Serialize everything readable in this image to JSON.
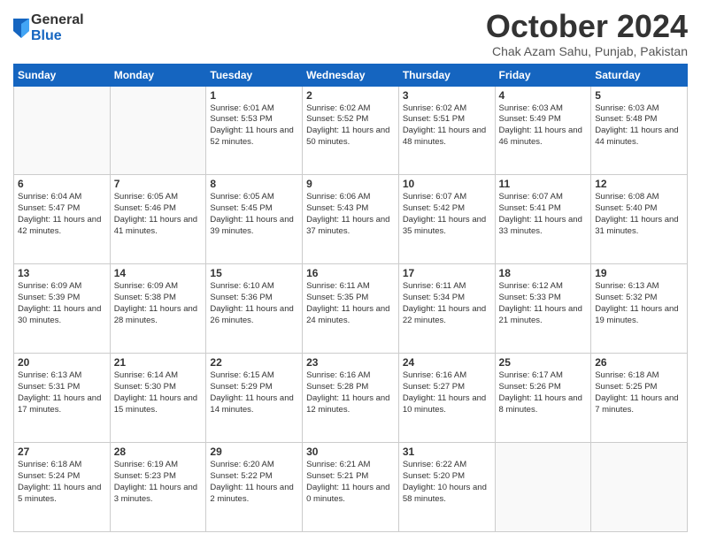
{
  "header": {
    "logo_general": "General",
    "logo_blue": "Blue",
    "title": "October 2024",
    "location": "Chak Azam Sahu, Punjab, Pakistan"
  },
  "columns": [
    "Sunday",
    "Monday",
    "Tuesday",
    "Wednesday",
    "Thursday",
    "Friday",
    "Saturday"
  ],
  "weeks": [
    [
      {
        "day": "",
        "empty": true
      },
      {
        "day": "",
        "empty": true
      },
      {
        "day": "1",
        "sunrise": "6:01 AM",
        "sunset": "5:53 PM",
        "daylight": "11 hours and 52 minutes."
      },
      {
        "day": "2",
        "sunrise": "6:02 AM",
        "sunset": "5:52 PM",
        "daylight": "11 hours and 50 minutes."
      },
      {
        "day": "3",
        "sunrise": "6:02 AM",
        "sunset": "5:51 PM",
        "daylight": "11 hours and 48 minutes."
      },
      {
        "day": "4",
        "sunrise": "6:03 AM",
        "sunset": "5:49 PM",
        "daylight": "11 hours and 46 minutes."
      },
      {
        "day": "5",
        "sunrise": "6:03 AM",
        "sunset": "5:48 PM",
        "daylight": "11 hours and 44 minutes."
      }
    ],
    [
      {
        "day": "6",
        "sunrise": "6:04 AM",
        "sunset": "5:47 PM",
        "daylight": "11 hours and 42 minutes."
      },
      {
        "day": "7",
        "sunrise": "6:05 AM",
        "sunset": "5:46 PM",
        "daylight": "11 hours and 41 minutes."
      },
      {
        "day": "8",
        "sunrise": "6:05 AM",
        "sunset": "5:45 PM",
        "daylight": "11 hours and 39 minutes."
      },
      {
        "day": "9",
        "sunrise": "6:06 AM",
        "sunset": "5:43 PM",
        "daylight": "11 hours and 37 minutes."
      },
      {
        "day": "10",
        "sunrise": "6:07 AM",
        "sunset": "5:42 PM",
        "daylight": "11 hours and 35 minutes."
      },
      {
        "day": "11",
        "sunrise": "6:07 AM",
        "sunset": "5:41 PM",
        "daylight": "11 hours and 33 minutes."
      },
      {
        "day": "12",
        "sunrise": "6:08 AM",
        "sunset": "5:40 PM",
        "daylight": "11 hours and 31 minutes."
      }
    ],
    [
      {
        "day": "13",
        "sunrise": "6:09 AM",
        "sunset": "5:39 PM",
        "daylight": "11 hours and 30 minutes."
      },
      {
        "day": "14",
        "sunrise": "6:09 AM",
        "sunset": "5:38 PM",
        "daylight": "11 hours and 28 minutes."
      },
      {
        "day": "15",
        "sunrise": "6:10 AM",
        "sunset": "5:36 PM",
        "daylight": "11 hours and 26 minutes."
      },
      {
        "day": "16",
        "sunrise": "6:11 AM",
        "sunset": "5:35 PM",
        "daylight": "11 hours and 24 minutes."
      },
      {
        "day": "17",
        "sunrise": "6:11 AM",
        "sunset": "5:34 PM",
        "daylight": "11 hours and 22 minutes."
      },
      {
        "day": "18",
        "sunrise": "6:12 AM",
        "sunset": "5:33 PM",
        "daylight": "11 hours and 21 minutes."
      },
      {
        "day": "19",
        "sunrise": "6:13 AM",
        "sunset": "5:32 PM",
        "daylight": "11 hours and 19 minutes."
      }
    ],
    [
      {
        "day": "20",
        "sunrise": "6:13 AM",
        "sunset": "5:31 PM",
        "daylight": "11 hours and 17 minutes."
      },
      {
        "day": "21",
        "sunrise": "6:14 AM",
        "sunset": "5:30 PM",
        "daylight": "11 hours and 15 minutes."
      },
      {
        "day": "22",
        "sunrise": "6:15 AM",
        "sunset": "5:29 PM",
        "daylight": "11 hours and 14 minutes."
      },
      {
        "day": "23",
        "sunrise": "6:16 AM",
        "sunset": "5:28 PM",
        "daylight": "11 hours and 12 minutes."
      },
      {
        "day": "24",
        "sunrise": "6:16 AM",
        "sunset": "5:27 PM",
        "daylight": "11 hours and 10 minutes."
      },
      {
        "day": "25",
        "sunrise": "6:17 AM",
        "sunset": "5:26 PM",
        "daylight": "11 hours and 8 minutes."
      },
      {
        "day": "26",
        "sunrise": "6:18 AM",
        "sunset": "5:25 PM",
        "daylight": "11 hours and 7 minutes."
      }
    ],
    [
      {
        "day": "27",
        "sunrise": "6:18 AM",
        "sunset": "5:24 PM",
        "daylight": "11 hours and 5 minutes."
      },
      {
        "day": "28",
        "sunrise": "6:19 AM",
        "sunset": "5:23 PM",
        "daylight": "11 hours and 3 minutes."
      },
      {
        "day": "29",
        "sunrise": "6:20 AM",
        "sunset": "5:22 PM",
        "daylight": "11 hours and 2 minutes."
      },
      {
        "day": "30",
        "sunrise": "6:21 AM",
        "sunset": "5:21 PM",
        "daylight": "11 hours and 0 minutes."
      },
      {
        "day": "31",
        "sunrise": "6:22 AM",
        "sunset": "5:20 PM",
        "daylight": "10 hours and 58 minutes."
      },
      {
        "day": "",
        "empty": true
      },
      {
        "day": "",
        "empty": true
      }
    ]
  ]
}
